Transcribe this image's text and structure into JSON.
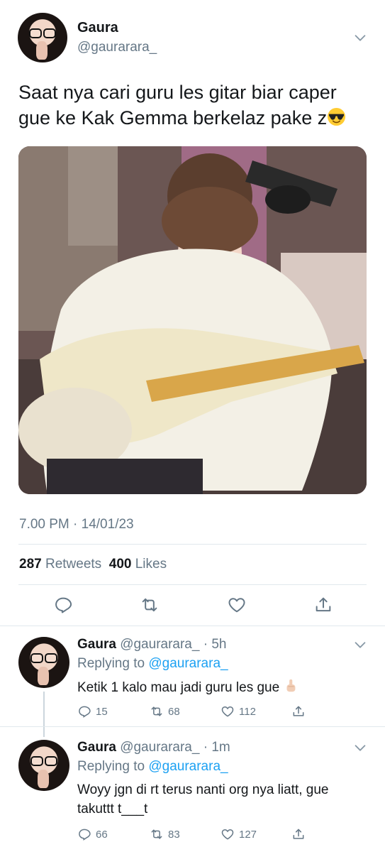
{
  "main_tweet": {
    "name": "Gaura",
    "handle": "@gaurarara_",
    "text": "Saat nya cari guru les gitar biar caper gue ke Kak Gemma berkelaz pake z",
    "emoji": "sunglasses-emoji",
    "timestamp": "7.00 PM · 14/01/23",
    "retweets_count": "287",
    "retweets_label": "Retweets",
    "likes_count": "400",
    "likes_label": "Likes"
  },
  "replies": [
    {
      "name": "Gaura",
      "meta": "@gaurarara_ · 5h",
      "replying_prefix": "Replying to ",
      "replying_to": "@gaurarara_",
      "text": "Ketik 1 kalo mau jadi guru les gue",
      "emoji": "pointing-up-emoji",
      "reply_count": "15",
      "retweet_count": "68",
      "like_count": "112"
    },
    {
      "name": "Gaura",
      "meta": "@gaurarara_ · 1m",
      "replying_prefix": "Replying to ",
      "replying_to": "@gaurarara_",
      "text": "Woyy jgn di rt terus nanti org nya liatt, gue takuttt t___t",
      "reply_count": "66",
      "retweet_count": "83",
      "like_count": "127"
    }
  ],
  "icons": {
    "reply": "reply-icon",
    "retweet": "retweet-icon",
    "like": "heart-icon",
    "share": "share-icon",
    "more": "chevron-down-icon"
  },
  "colors": {
    "accent": "#1da1f2",
    "secondary_text": "#657786",
    "divider": "#e1e8ed"
  }
}
